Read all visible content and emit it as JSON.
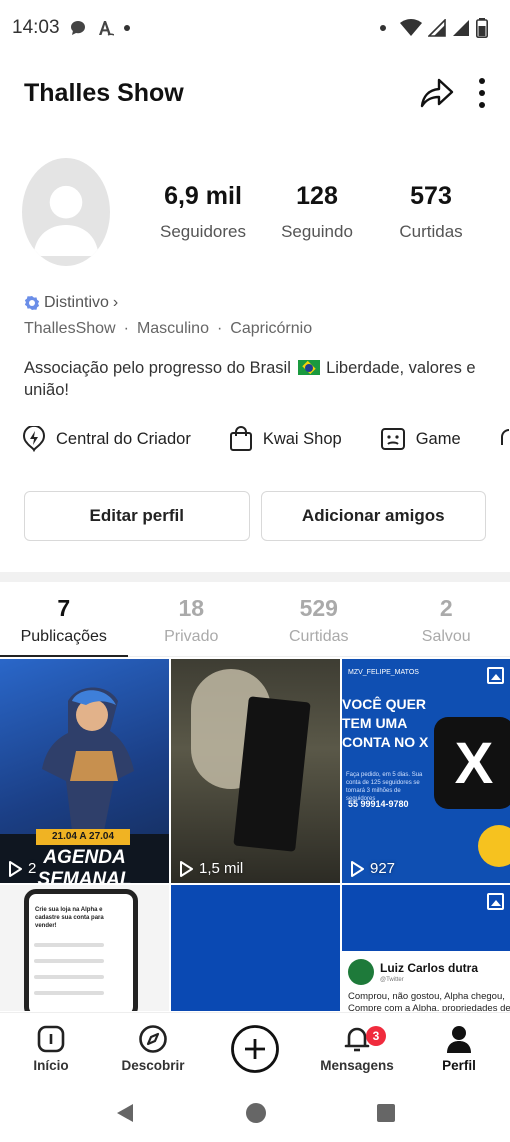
{
  "status_bar": {
    "time": "14:03",
    "icons_left": [
      "chat-bubble-icon",
      "font-a-icon",
      "dot-icon"
    ],
    "icons_right": [
      "dot-icon",
      "wifi-icon",
      "signal-icon",
      "signal-icon",
      "battery-icon"
    ]
  },
  "header": {
    "title": "Thalles Show",
    "actions": [
      "share-icon",
      "more-vertical-icon"
    ]
  },
  "profile": {
    "stats": [
      {
        "value": "6,9 mil",
        "label": "Seguidores"
      },
      {
        "value": "128",
        "label": "Seguindo"
      },
      {
        "value": "573",
        "label": "Curtidas"
      }
    ],
    "badge_label": "Distintivo",
    "badge_chevron": "›",
    "info": [
      "ThallesShow",
      "Masculino",
      "Capricórnio"
    ],
    "info_separator": "·",
    "bio_before_flag": "Associação pelo progresso do Brasil",
    "bio_after_flag": "Liberdade, valores e união!"
  },
  "shortcuts": [
    {
      "label": "Central do Criador",
      "icon": "creator-bolt-icon"
    },
    {
      "label": "Kwai Shop",
      "icon": "shopping-bag-icon"
    },
    {
      "label": "Game",
      "icon": "game-controller-icon"
    }
  ],
  "buttons": {
    "edit": "Editar perfil",
    "add_friends": "Adicionar amigos"
  },
  "tabs": [
    {
      "count": "7",
      "label": "Publicações",
      "active": true
    },
    {
      "count": "18",
      "label": "Privado"
    },
    {
      "count": "529",
      "label": "Curtidas"
    },
    {
      "count": "2",
      "label": "Salvou"
    }
  ],
  "grid": {
    "items": [
      {
        "views": "2",
        "type": "video",
        "banner_dates": "21.04 A 27.04",
        "banner_title": "AGENDA SEMANAL"
      },
      {
        "views": "1,5 mil",
        "type": "video"
      },
      {
        "views": "927",
        "type": "image",
        "top_text": "MZV_FELIPE_MATOS",
        "headline": "VOCÊ QUER TEM UMA CONTA NO X",
        "body": "Faça pedido, em 5 dias. Sua conta de 125 seguidores se tornará 3 milhões de seguidores",
        "phone": "55 99914-9780",
        "logo": "X"
      },
      {
        "type": "image",
        "phone_headline": "Crie sua loja na Alpha e cadastre sua conta para vender!"
      },
      {
        "type": "image"
      },
      {
        "type": "image",
        "tweet_name": "Luiz Carlos dutra",
        "tweet_handle": "@Twitter",
        "tweet_text_1": "Comprou, não gostou, Alpha chegou,",
        "tweet_text_2": "Compre com a Alpha, propriedades de"
      }
    ]
  },
  "bottom_nav": [
    {
      "label": "Início",
      "icon": "home-icon"
    },
    {
      "label": "Descobrir",
      "icon": "compass-icon"
    },
    {
      "label": "",
      "icon": "add-circle-icon"
    },
    {
      "label": "Mensagens",
      "icon": "bell-icon",
      "badge": "3"
    },
    {
      "label": "Perfil",
      "icon": "person-icon",
      "active": true
    }
  ],
  "system_nav": [
    "back-icon",
    "home-circle-icon",
    "recents-icon"
  ]
}
